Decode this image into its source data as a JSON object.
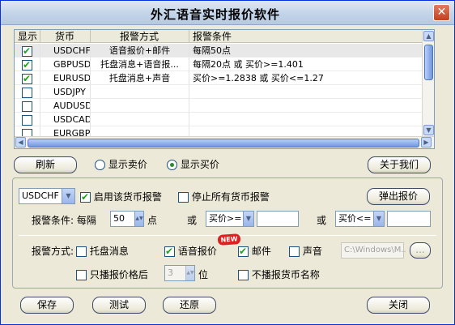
{
  "window": {
    "title": "外汇语音实时报价软件",
    "close_glyph": "✕"
  },
  "table": {
    "columns": [
      "显示",
      "货币",
      "报警方式",
      "报警条件"
    ],
    "rows": [
      {
        "checked": true,
        "currency": "USDCHF",
        "method": "语音报价+邮件",
        "condition": "每隔50点"
      },
      {
        "checked": true,
        "currency": "GBPUSD",
        "method": "托盘消息+语音报...",
        "condition": "每隔20点 或 买价>=1.401"
      },
      {
        "checked": true,
        "currency": "EURUSD",
        "method": "托盘消息+声音",
        "condition": "买价>=1.2838 或 买价<=1.27"
      },
      {
        "checked": false,
        "currency": "USDJPY",
        "method": "",
        "condition": ""
      },
      {
        "checked": false,
        "currency": "AUDUSD",
        "method": "",
        "condition": ""
      },
      {
        "checked": false,
        "currency": "USDCAD",
        "method": "",
        "condition": ""
      },
      {
        "checked": false,
        "currency": "EURGBP",
        "method": "",
        "condition": ""
      }
    ]
  },
  "price_bar": {
    "refresh": "刷新",
    "show_sell": "显示卖价",
    "show_buy": "显示买价",
    "about": "关于我们",
    "selected": "show_buy"
  },
  "currency_panel": {
    "currency": "USDCHF",
    "enable_alarm": "启用该货币报警",
    "stop_all": "停止所有货币报警",
    "popup_quote": "弹出报价",
    "condition_label": "报警条件: 每隔",
    "interval": "50",
    "points": "点",
    "or1": "或",
    "op1": "买价>=",
    "or2": "或",
    "op2": "买价<=",
    "method_label": "报警方式:",
    "tray": "托盘消息",
    "voice": "语音报价",
    "new_badge": "NEW",
    "mail": "邮件",
    "sound": "声音",
    "sound_path": "C:\\Windows\\M..",
    "browse": "...",
    "only_broadcast": "只播报价格后",
    "digits": "3",
    "digit_unit": "位",
    "no_currency_name": "不播报货币名称"
  },
  "footer": {
    "save": "保存",
    "test": "测试",
    "restore": "还原",
    "close": "关闭"
  }
}
